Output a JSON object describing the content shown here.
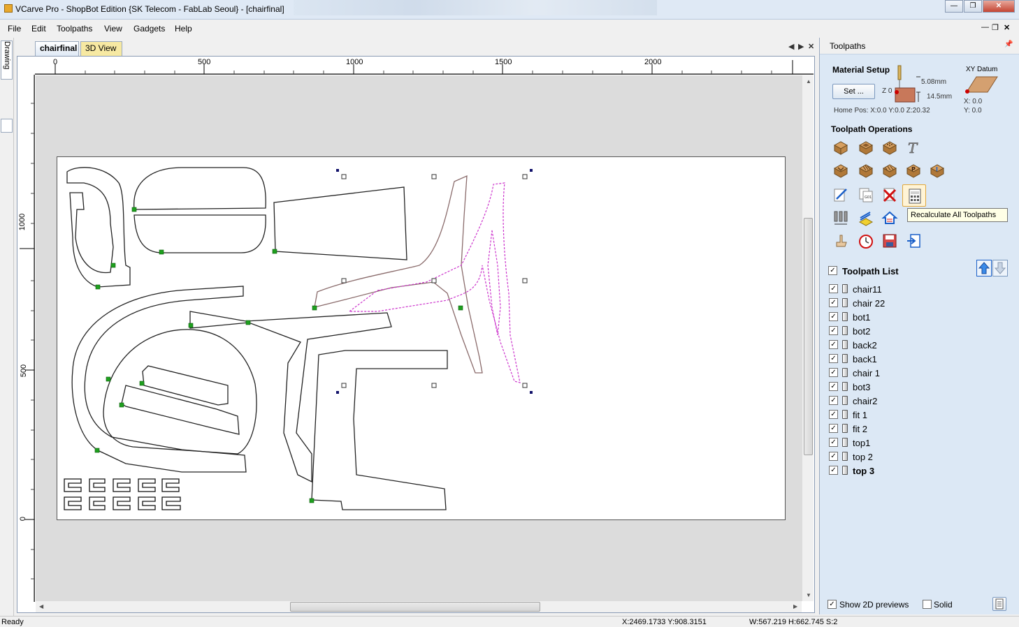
{
  "window": {
    "title": "VCarve Pro - ShopBot Edition {SK Telecom - FabLab Seoul} - [chairfinal]",
    "controls": [
      "minimize",
      "maximize",
      "close"
    ]
  },
  "menu": {
    "items": [
      "File",
      "Edit",
      "Toolpaths",
      "View",
      "Gadgets",
      "Help"
    ]
  },
  "left_strip": {
    "drawing_tab": "Drawing"
  },
  "tabs": {
    "drawing": "chairfinal",
    "view3d": "3D View"
  },
  "ruler": {
    "top_ticks": [
      "0",
      "500",
      "1000",
      "1500",
      "2000"
    ],
    "left_ticks": [
      "1000",
      "500",
      "0"
    ]
  },
  "panel": {
    "title": "Toolpaths",
    "material_setup": {
      "title": "Material Setup",
      "set_button": "Set ...",
      "z0_label": "Z 0",
      "thickness_top": "5.08mm",
      "thickness": "14.5mm",
      "home_pos": "Home Pos:  X:0.0 Y:0.0 Z:20.32"
    },
    "xy_datum": {
      "title": "XY Datum",
      "x": "X: 0.0",
      "y": "Y: 0.0"
    },
    "operations_title": "Toolpath Operations",
    "tooltip": "Recalculate All Toolpaths",
    "list_title": "Toolpath List",
    "toolpaths": [
      {
        "name": "chair11",
        "checked": true
      },
      {
        "name": "chair 22",
        "checked": true
      },
      {
        "name": "bot1",
        "checked": true
      },
      {
        "name": "bot2",
        "checked": true
      },
      {
        "name": "back2",
        "checked": true
      },
      {
        "name": "back1",
        "checked": true
      },
      {
        "name": "chair 1",
        "checked": true
      },
      {
        "name": "bot3",
        "checked": true
      },
      {
        "name": "chair2",
        "checked": true
      },
      {
        "name": "fit 1",
        "checked": true
      },
      {
        "name": "fit 2",
        "checked": true
      },
      {
        "name": "top1",
        "checked": true
      },
      {
        "name": "top 2",
        "checked": true
      },
      {
        "name": "top 3",
        "checked": true
      }
    ],
    "show_2d_previews": "Show 2D previews",
    "solid": "Solid"
  },
  "status": {
    "state": "Ready",
    "coords": "X:2469.1733 Y:908.3151",
    "size": "W:567.219   H:662.745  S:2"
  },
  "colors": {
    "accent": "#dce8f5",
    "toolpath_line": "#000000",
    "selected_vector": "#cc33cc",
    "start_point": "#1ea01e"
  }
}
